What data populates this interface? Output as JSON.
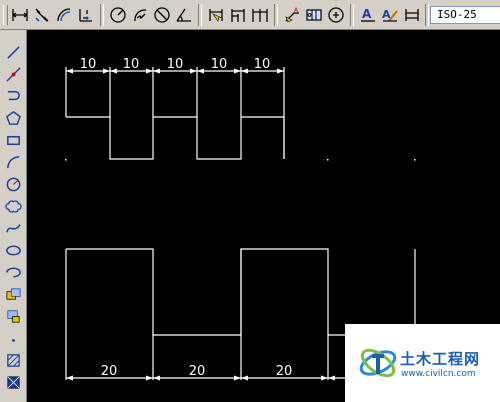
{
  "toolbar": {
    "dim_style": "ISO-25",
    "buttons": [
      "linear-dimension-icon",
      "aligned-dimension-icon",
      "arc-length-icon",
      "ordinate-dimension-icon",
      "radius-dimension-icon",
      "jogged-dimension-icon",
      "diameter-dimension-icon",
      "angular-dimension-icon",
      "quick-dimension-icon",
      "baseline-dimension-icon",
      "continue-dimension-icon",
      "quick-leader-icon",
      "tolerance-icon",
      "center-mark-icon",
      "dimension-edit-icon",
      "dimension-text-edit-icon",
      "dimension-update-icon"
    ]
  },
  "draw_tools": [
    "line-icon",
    "construction-line-icon",
    "polyline-icon",
    "polygon-icon",
    "rectangle-icon",
    "arc-icon",
    "circle-icon",
    "revision-cloud-icon",
    "spline-icon",
    "ellipse-icon",
    "ellipse-arc-icon",
    "insert-block-icon",
    "make-block-icon",
    "point-icon",
    "hatch-icon",
    "gradient-icon"
  ],
  "drawing": {
    "top_dimensions": [
      "10",
      "10",
      "10",
      "10",
      "10"
    ],
    "bottom_dimensions": [
      "20",
      "20",
      "20"
    ]
  },
  "watermark": {
    "name": "土木工程网",
    "url": "www.civilcn.com"
  },
  "colors": {
    "canvas": "#000000",
    "geometry": "#ffffff",
    "toolbar": "#d4d0c8",
    "logo_blue": "#1a5fae"
  }
}
